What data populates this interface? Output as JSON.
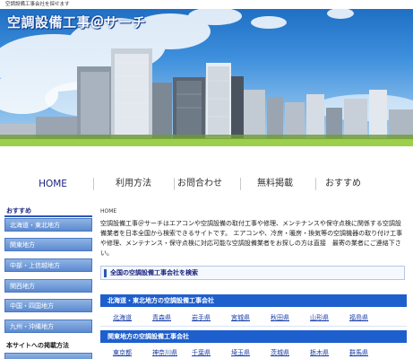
{
  "top_text": "空調設備工事会社を探せます",
  "site_title": "空調設備工事＠サーチ",
  "nav": {
    "items": [
      "HOME",
      "利用方法",
      "お問合わせ",
      "無料掲載",
      "おすすめ"
    ]
  },
  "sidebar": {
    "heading": "おすすめ",
    "items": [
      "北海道・東北地方",
      "関東地方",
      "中部・上信越地方",
      "関西地方",
      "中国・四国地方",
      "九州・沖縄地方"
    ],
    "heading2": "本サイトへの掲載方法"
  },
  "main": {
    "breadcrumb": "HOME",
    "intro": "空調設備工事＠サーチはエアコンや空調設備の取付工事や修理、メンテナンスや保守点検に関係する空調設備業者を日本全国から検索できるサイトです。 エアコンや、冷房・暖房・換気等の空調機器の取り付け工事や修理、メンテナンス・保守点検に対応可能な空調設備業者をお探しの方は直接　最寄の業者にご連絡下さい。",
    "search_heading": "全国の空調設備工事会社を検索",
    "regions": [
      {
        "title": "北海道・東北地方の空調設備工事会社",
        "prefs": [
          "北海道",
          "青森県",
          "岩手県",
          "宮城県",
          "秋田県",
          "山形県",
          "福島県"
        ]
      },
      {
        "title": "関東地方の空調設備工事会社",
        "prefs": [
          "東京都",
          "神奈川県",
          "千葉県",
          "埼玉県",
          "茨城県",
          "栃木県",
          "群馬県"
        ]
      }
    ]
  }
}
